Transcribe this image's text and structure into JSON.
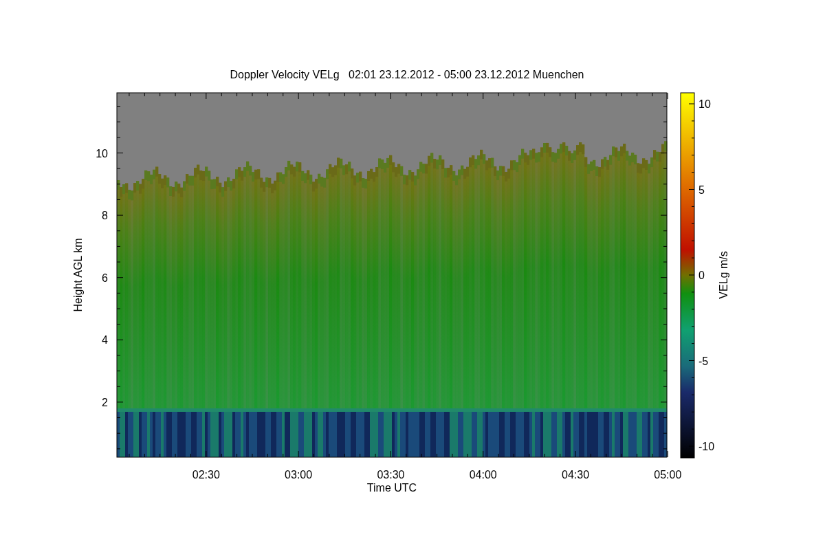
{
  "title": "Doppler Velocity VELg   02:01 23.12.2012 - 05:00 23.12.2012 Muenchen",
  "x_axis": {
    "label": "Time UTC",
    "ticks": [
      "02:30",
      "03:00",
      "03:30",
      "04:00",
      "04:30",
      "05:00"
    ]
  },
  "y_axis": {
    "label": "Height AGL km",
    "ticks": [
      "10",
      "8",
      "6",
      "4",
      "2"
    ]
  },
  "colorbar": {
    "label": "VELg m/s",
    "ticks": [
      "10",
      "5",
      "0",
      "-5",
      "-10"
    ]
  }
}
